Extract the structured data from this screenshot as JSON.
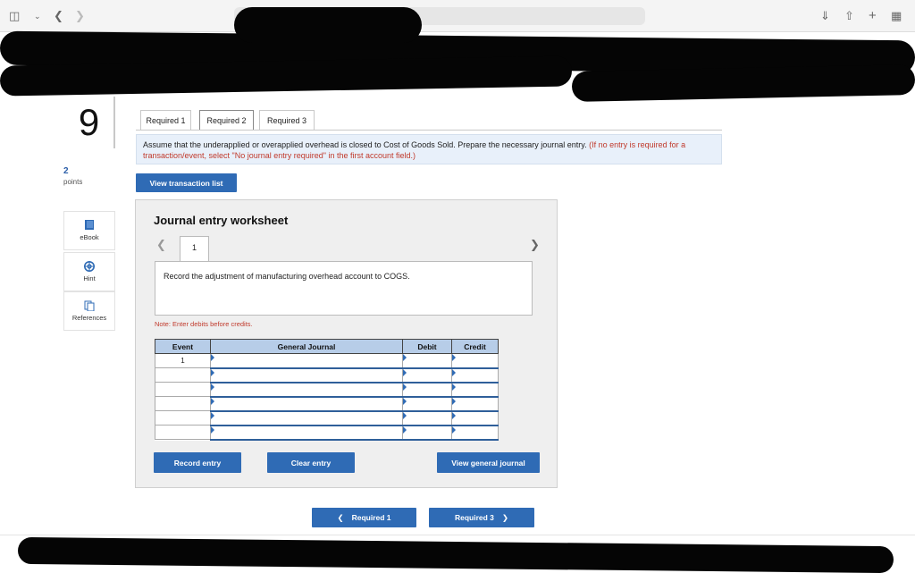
{
  "question": {
    "number": "9",
    "points_value": "2",
    "points_label": "points"
  },
  "tools": [
    {
      "label": "eBook",
      "icon": "book-icon"
    },
    {
      "label": "Hint",
      "icon": "hint-icon"
    },
    {
      "label": "References",
      "icon": "references-icon"
    }
  ],
  "tabs": [
    "Required 1",
    "Required 2",
    "Required 3"
  ],
  "instructions": {
    "main": "Assume that the underapplied or overapplied overhead is closed to Cost of Goods Sold. Prepare the necessary journal entry.",
    "note": "(If no entry is required for a transaction/event, select \"No journal entry required\" in the first account field.)"
  },
  "view_transaction_label": "View transaction list",
  "worksheet": {
    "title": "Journal entry worksheet",
    "page": "1",
    "description": "Record the adjustment of manufacturing overhead account to COGS.",
    "note": "Note: Enter debits before credits.",
    "columns": [
      "Event",
      "General Journal",
      "Debit",
      "Credit"
    ],
    "rows": [
      "1",
      "",
      "",
      "",
      "",
      ""
    ],
    "record_label": "Record entry",
    "clear_label": "Clear entry",
    "view_journal_label": "View general journal"
  },
  "nav": {
    "prev_label": "Required 1",
    "next_label": "Required 3"
  },
  "colors": {
    "primary": "#2f6bb5",
    "table_header": "#b7cde8",
    "note_red": "#c0392b"
  }
}
